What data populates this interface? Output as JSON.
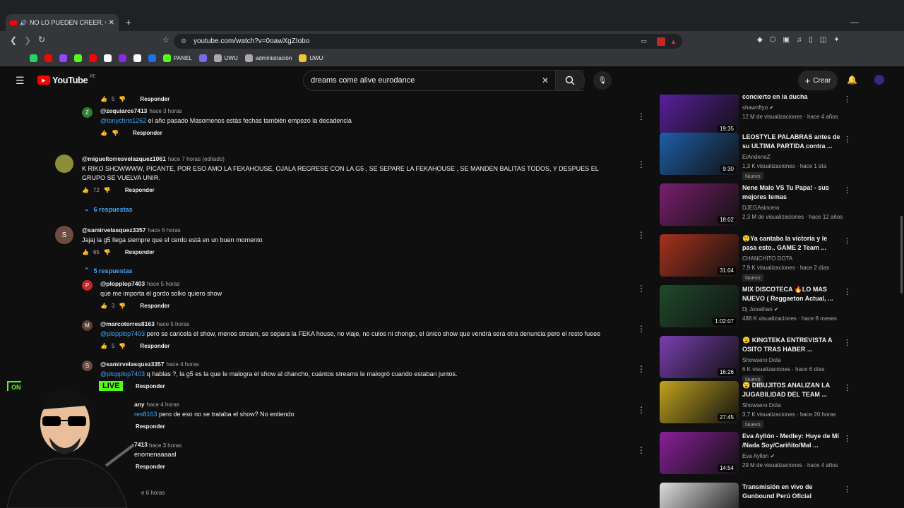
{
  "browser": {
    "tab_title": "NO LO PUEDEN CREER, CI",
    "url": "youtube.com/watch?v=0oawXgZIobo",
    "bookmarks": [
      {
        "label": "",
        "color": "#25d366"
      },
      {
        "label": "",
        "color": "#ff0000"
      },
      {
        "label": "",
        "color": "#9146ff"
      },
      {
        "label": "",
        "color": "#53fc18"
      },
      {
        "label": "",
        "color": "#ff0000"
      },
      {
        "label": "",
        "color": "#ffffff"
      },
      {
        "label": "",
        "color": "#8a2be2"
      },
      {
        "label": "",
        "color": "#ffffff"
      },
      {
        "label": "",
        "color": "#1a73e8"
      },
      {
        "label": "PANEL",
        "color": "#53fc18"
      },
      {
        "label": "",
        "color": "#7b68ee"
      },
      {
        "label": "UWU",
        "color": "#aaaaaa"
      },
      {
        "label": "administración",
        "color": "#aaaaaa"
      },
      {
        "label": "UWU",
        "color": "#f4c430"
      }
    ]
  },
  "youtube": {
    "logo": "YouTube",
    "region": "PE",
    "search_value": "dreams come alive eurodance",
    "create_label": "Crear"
  },
  "comments": [
    {
      "handle": "",
      "time": "",
      "text": "",
      "likes": "5",
      "reply": "Responder"
    },
    {
      "handle": "@zequiarce7413",
      "time": "hace 3 horas",
      "mention": "@tonychris1262",
      "text": " el año pasado Masomenos estás fechas también empezo  la decadencia",
      "likes": "",
      "reply": "Responder"
    },
    {
      "handle": "@migueltorresvelazquez1061",
      "time": "hace 7 horas (editado)",
      "text": "K RIKO SHOWWWW, PICANTE, POR ESO AMO LA FEKAHOUSE, OJALA REGRESE CON LA G5 , SE SEPARE LA FEKAHOUSE , SE MANDEN BALITAS TODOS, Y DESPUES EL GRUPO  SE VUELVA UNIR.",
      "likes": "72",
      "reply": "Responder",
      "replies": "6 respuestas"
    },
    {
      "handle": "@samirvelasquez3357",
      "time": "hace 6 horas",
      "text": "Jajaj la g5 llega siempre que el cerdo está en un buen momento",
      "likes": "65",
      "reply": "Responder",
      "replies": "5 respuestas"
    },
    {
      "handle": "@plopplop7403",
      "time": "hace 5 horas",
      "text": "que me importa el gordo solko quiero show",
      "likes": "3",
      "reply": "Responder"
    },
    {
      "handle": "@marcotorres8163",
      "time": "hace 5 horas",
      "mention": "@plopplop7403",
      "text": "  pero se cancela el show, menos stream, se separa la FEKA house, no viaje, no culos ni chongo, el único show que vendrá será otra denuncia pero el resto fueee",
      "likes": "5",
      "reply": "Responder"
    },
    {
      "handle": "@samirvelasquez3357",
      "time": "hace 4 horas",
      "mention": "@plopplop7403",
      "text": " q hablas ?, la g5 es la que le malogra el show al chancho, cuántos streams le malogró cuando estaban juntos.",
      "likes": "",
      "reply": "Responder"
    },
    {
      "handle": "any",
      "time": "hace 4 horas",
      "mention": "res8163",
      "text": "  pero de eso no se trataba el show? No entiendo",
      "likes": "",
      "reply": "Responder"
    },
    {
      "handle": "7413",
      "time": "hace 3 horas",
      "text": "enomenaaaaal",
      "likes": "",
      "reply": "Responder"
    },
    {
      "handle": "",
      "time": "e 6 horas",
      "text": "",
      "likes": "",
      "reply": ""
    }
  ],
  "overlay": {
    "live": "LIVE",
    "on": "ON"
  },
  "sidebar": [
    {
      "title": "concierto en la ducha",
      "channel": "shawnftyo",
      "meta": "12 M de visualizaciones · hace 4 años",
      "duration": "19:35",
      "nuevo": "",
      "thumb": "#5a1fa0",
      "verified": true
    },
    {
      "title": "LEOSTYLE PALABRAS antes de su ULTIMA PARTIDA contra ...",
      "channel": "ElAndenoZ",
      "meta": "1,3 K visualizaciones · hace 1 día",
      "duration": "9:30",
      "nuevo": "Nuevo",
      "thumb": "#1d5fa8",
      "verified": false
    },
    {
      "title": "Nene Malo VS Tu Papa! - sus mejores temas",
      "channel": "DJEGAsincero",
      "meta": "2,3 M de visualizaciones · hace 12 años",
      "duration": "18:02",
      "nuevo": "",
      "thumb": "#7a1f6e",
      "verified": false
    },
    {
      "title": "😲Ya cantaba la victoria y le pasa esto.. GAME 2 Team ...",
      "channel": "CHANCHITO DOTA",
      "meta": "7,9 K visualizaciones · hace 2 días",
      "duration": "31:04",
      "nuevo": "Nuevo",
      "thumb": "#a8321d",
      "verified": false
    },
    {
      "title": "MIX DISCOTECA 🔥LO MAS NUEVO ( Reggaeton Actual, ...",
      "channel": "Dj Jonathan",
      "meta": "488 K visualizaciones · hace 8 meses",
      "duration": "1:02:07",
      "nuevo": "",
      "thumb": "#1f4a2a",
      "verified": true
    },
    {
      "title": "😮 KINGTEKA ENTREVISTA A OSITO TRAS HABER ...",
      "channel": "Showsero Dota",
      "meta": "6 K visualizaciones · hace 6 días",
      "duration": "16:26",
      "nuevo": "Nuevo",
      "thumb": "#7a3fb0",
      "verified": false
    },
    {
      "title": "😮 DIBUJITOS ANALIZAN LA JUGABILIDAD DEL TEAM ...",
      "channel": "Showsero Dota",
      "meta": "3,7 K visualizaciones · hace 20 horas",
      "duration": "27:45",
      "nuevo": "Nuevo",
      "thumb": "#c0a21d",
      "verified": false
    },
    {
      "title": "Eva Ayllón - Medley: Huye de Mí /Nada Soy/Cariñito/Mal ...",
      "channel": "Eva Ayllon",
      "meta": "29 M de visualizaciones · hace 4 años",
      "duration": "14:54",
      "nuevo": "",
      "thumb": "#8a1f9a",
      "verified": true
    },
    {
      "title": "Transmisión en vivo de Gunbound Perú Oficial",
      "channel": "",
      "meta": "",
      "duration": "",
      "nuevo": "",
      "thumb": "#dddddd",
      "verified": false
    }
  ]
}
